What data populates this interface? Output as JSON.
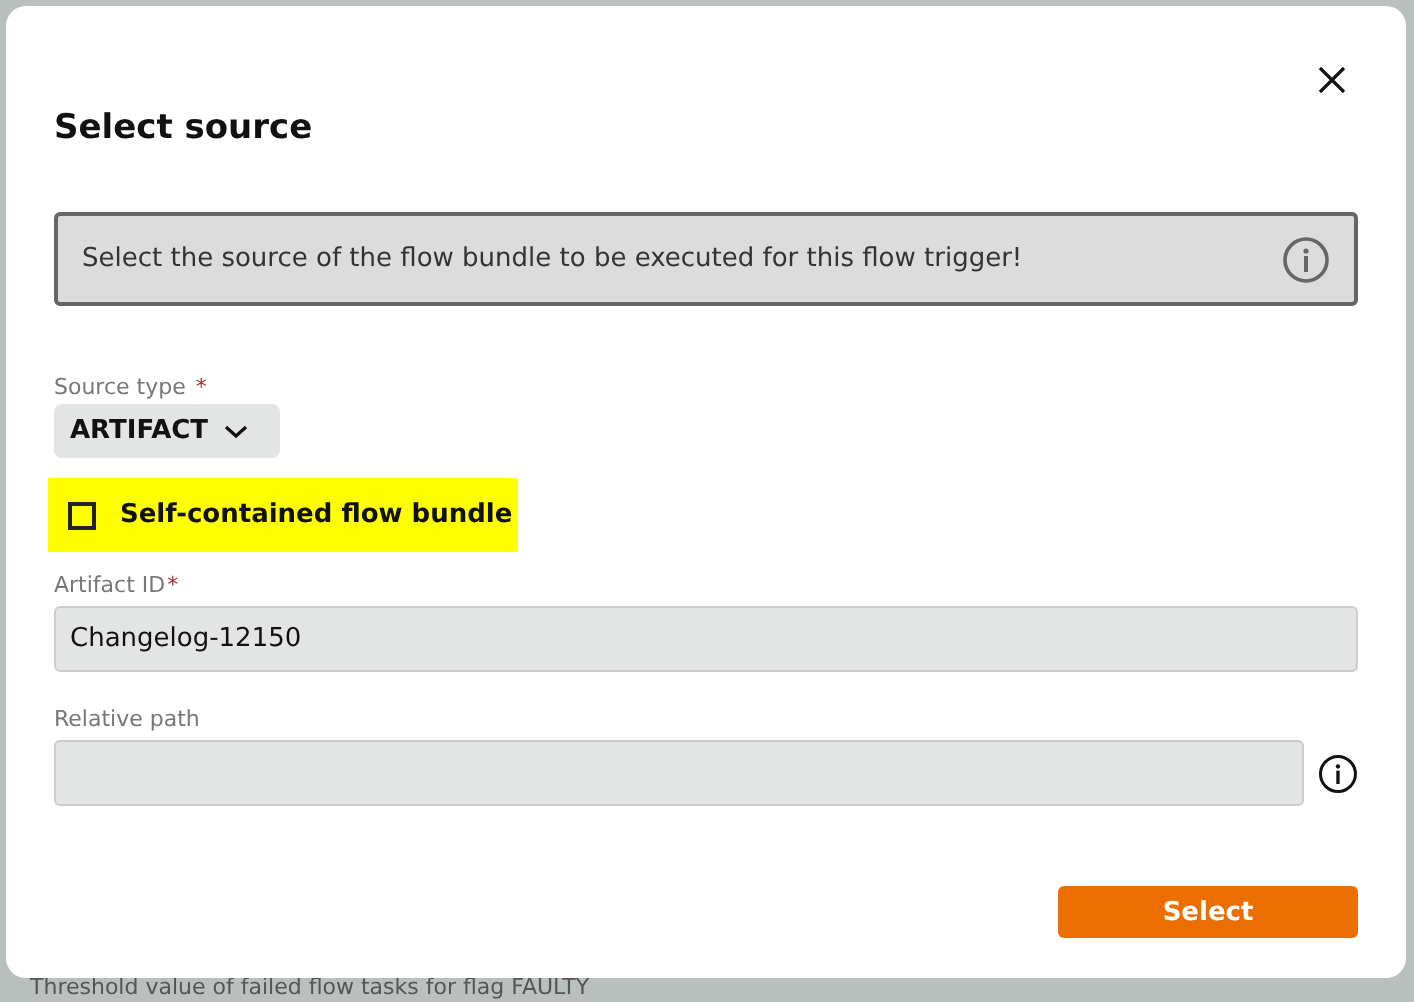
{
  "dialog": {
    "title": "Select source",
    "info_message": "Select the source of the flow bundle to be executed for this flow trigger!",
    "source_type": {
      "label": "Source type",
      "required_mark": "*",
      "value": "ARTIFACT"
    },
    "self_contained": {
      "label": "Self-contained flow bundle",
      "checked": false
    },
    "artifact_id": {
      "label": "Artifact ID",
      "required_mark": "*",
      "value": "Changelog-12150"
    },
    "relative_path": {
      "label": "Relative path"
    },
    "primary_button": "Select"
  },
  "background_text": "Threshold value of failed flow tasks for flag FAULTY"
}
